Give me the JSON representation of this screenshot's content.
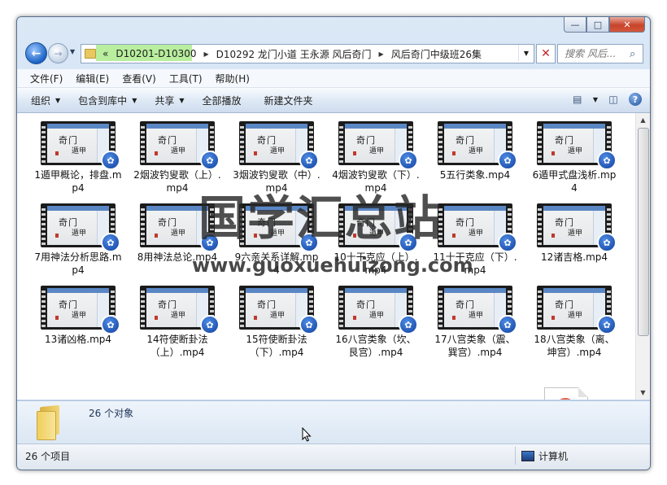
{
  "window": {
    "controls": {
      "minimize": "—",
      "maximize": "□",
      "close": "✕"
    }
  },
  "address": {
    "overflow": "«",
    "crumbs": [
      "D10201-D10300",
      "D10292 龙门小道 王永源 风后奇门",
      "风后奇门中级班26集"
    ],
    "search_placeholder": "搜索 风后..."
  },
  "menu": [
    "文件(F)",
    "编辑(E)",
    "查看(V)",
    "工具(T)",
    "帮助(H)"
  ],
  "toolbar": {
    "organize": "组织",
    "include_library": "包含到库中",
    "share": "共享",
    "play_all": "全部播放",
    "new_folder": "新建文件夹"
  },
  "thumb_text": {
    "line1": "奇门",
    "line2": "遁甲"
  },
  "files": [
    "1遁甲概论，排盘.mp4",
    "2烟波钓叟歌（上）.mp4",
    "3烟波钓叟歌（中）.mp4",
    "4烟波钓叟歌（下）.mp4",
    "5五行类象.mp4",
    "6遁甲式盘浅析.mp4",
    "7用神法分析思路.mp4",
    "8用神法总论.mp4",
    "9六亲关系详解.mp4",
    "10十干克应（上）.mp4",
    "11十干克应（下）.mp4",
    "12诸吉格.mp4",
    "13诸凶格.mp4",
    "14符使断卦法（上）.mp4",
    "15符使断卦法（下）.mp4",
    "16八宫类象（坎、艮宫）.mp4",
    "17八宫类象（震、巽宫）.mp4",
    "18八宫类象（离、坤宫）.mp4"
  ],
  "details": {
    "count": "26 个对象"
  },
  "status": {
    "items": "26 个项目",
    "location": "计算机"
  },
  "watermark": {
    "title": "国学汇总站",
    "url": "www.guoxuehuizong.com"
  }
}
